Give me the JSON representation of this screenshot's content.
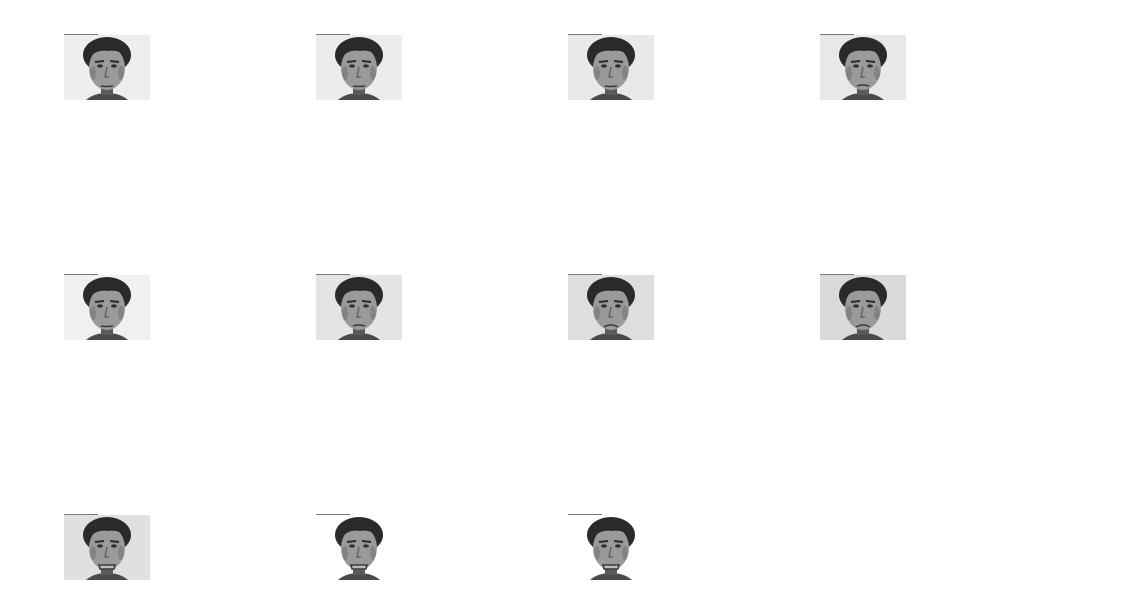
{
  "figure": {
    "columns": 4,
    "rows": 3,
    "frames": [
      {
        "index": 1,
        "background": "#eeeeee",
        "expression": "neutral"
      },
      {
        "index": 2,
        "background": "#ececec",
        "expression": "neutral"
      },
      {
        "index": 3,
        "background": "#e9e9e9",
        "expression": "neutral"
      },
      {
        "index": 4,
        "background": "#e8e8e8",
        "expression": "slight-frown"
      },
      {
        "index": 5,
        "background": "#f0f0f0",
        "expression": "neutral"
      },
      {
        "index": 6,
        "background": "#e4e4e4",
        "expression": "slight-frown"
      },
      {
        "index": 7,
        "background": "#dedede",
        "expression": "frown"
      },
      {
        "index": 8,
        "background": "#dadada",
        "expression": "frown"
      },
      {
        "index": 9,
        "background": "#e0e0e0",
        "expression": "grimace"
      },
      {
        "index": 10,
        "background": "#ffffff",
        "expression": "grimace"
      },
      {
        "index": 11,
        "background": "#ffffff",
        "expression": "grimace"
      }
    ]
  },
  "colors": {
    "page": "#ffffff",
    "hair": "#2a2a2a",
    "skin": "#9a9a9a",
    "shadow": "#5a5a5a",
    "shirt": "#4a4a4a"
  }
}
